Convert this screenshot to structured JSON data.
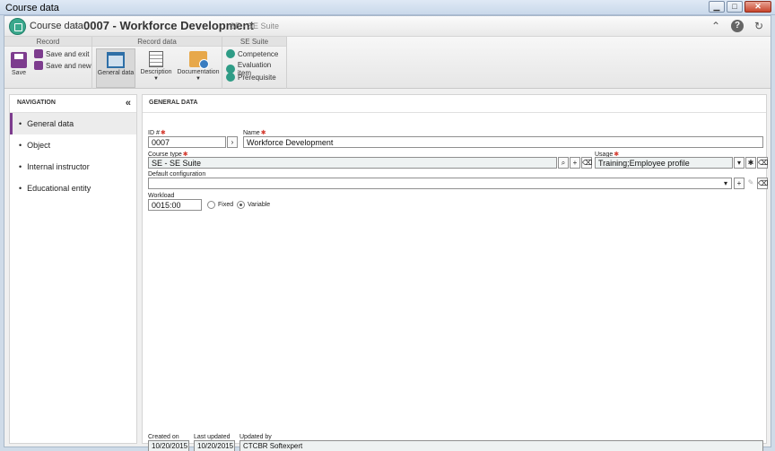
{
  "window": {
    "title": "Course data",
    "controls": {
      "minimize": "▁",
      "maximize": "□",
      "close": "✕"
    }
  },
  "header": {
    "breadcrumb": "Course data",
    "separator": "›",
    "record_title": "0007 - Workforce Development",
    "suite_tag": "SE - SE Suite",
    "icons": [
      "collapse-up-icon",
      "help-icon",
      "refresh-icon"
    ],
    "icon_glyphs": {
      "collapse": "⌃",
      "help": "?",
      "refresh": "↻"
    }
  },
  "ribbon": {
    "groups": {
      "record": "Record",
      "record_data": "Record data",
      "se_suite": "SE Suite"
    },
    "save": "Save",
    "save_and_exit": "Save and exit",
    "save_and_new": "Save and new",
    "general_data": "General data",
    "description": "Description",
    "documentation": "Documentation",
    "caret": "▼",
    "competence": "Competence",
    "evaluation_item": "Evaluation item",
    "prerequisite": "Prerequisite"
  },
  "navigation": {
    "title": "NAVIGATION",
    "collapse": "«",
    "items": [
      {
        "label": "General data",
        "active": true
      },
      {
        "label": "Object",
        "active": false
      },
      {
        "label": "Internal instructor",
        "active": false
      },
      {
        "label": "Educational entity",
        "active": false
      }
    ]
  },
  "general": {
    "title": "GENERAL DATA",
    "id_label": "ID #",
    "id_value": "0007",
    "name_label": "Name",
    "name_value": "Workforce Development",
    "course_type_label": "Course type",
    "course_type_value": "SE - SE Suite",
    "usage_label": "Usage",
    "usage_value": "Training;Employee profile",
    "default_config_label": "Default configuration",
    "default_config_value": "",
    "workload_label": "Workload",
    "workload_value": "0015:00",
    "fixed_label": "Fixed",
    "variable_label": "Variable",
    "selected_workload_mode": "Variable",
    "required_mark": "✱",
    "buttons": {
      "arrow": "›",
      "search": "⌕",
      "add": "+",
      "clear": "⌫",
      "dropdown": "▾",
      "multi": "✱",
      "edit": "✎"
    }
  },
  "footer": {
    "created_on_label": "Created on",
    "created_on_value": "10/20/2015",
    "last_updated_label": "Last updated",
    "last_updated_value": "10/20/2015",
    "updated_by_label": "Updated by",
    "updated_by_value": "CTCBR Softexpert"
  },
  "colors": {
    "accent": "#7d3c8e",
    "brand": "#3aa88c",
    "required": "#d43a2e"
  }
}
